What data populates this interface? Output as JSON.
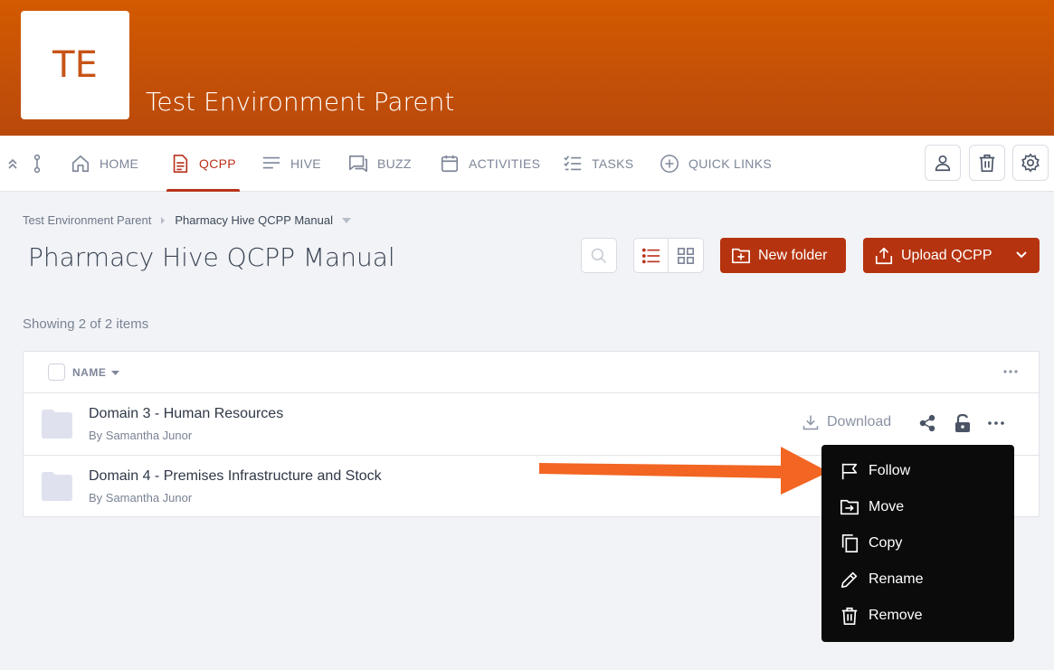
{
  "site": {
    "logo_initials": "TE",
    "title": "Test Environment Parent"
  },
  "nav": {
    "items": [
      {
        "label": "HOME",
        "icon": "home-icon"
      },
      {
        "label": "QCPP",
        "icon": "document-icon",
        "active": true
      },
      {
        "label": "HIVE",
        "icon": "lines-icon"
      },
      {
        "label": "BUZZ",
        "icon": "chat-icon"
      },
      {
        "label": "ACTIVITIES",
        "icon": "calendar-icon"
      },
      {
        "label": "TASKS",
        "icon": "checklist-icon"
      },
      {
        "label": "QUICK LINKS",
        "icon": "plus-circle-icon"
      }
    ]
  },
  "breadcrumb": {
    "parent": "Test Environment Parent",
    "current": "Pharmacy Hive QCPP Manual"
  },
  "page": {
    "title": "Pharmacy Hive QCPP Manual"
  },
  "toolbar": {
    "new_folder": "New folder",
    "upload": "Upload QCPP"
  },
  "listing": {
    "count_text": "Showing 2 of 2 items",
    "column_name": "NAME",
    "rows": [
      {
        "title": "Domain 3 - Human Resources",
        "author": "By Samantha Junor",
        "download": "Download"
      },
      {
        "title": "Domain 4 - Premises Infrastructure and Stock",
        "author": "By Samantha Junor"
      }
    ]
  },
  "context_menu": {
    "items": [
      "Follow",
      "Move",
      "Copy",
      "Rename",
      "Remove"
    ]
  },
  "colors": {
    "banner": "#c75416",
    "accent": "#b5330f",
    "menu_bg": "#0b0b0b",
    "arrow": "#f26522"
  }
}
